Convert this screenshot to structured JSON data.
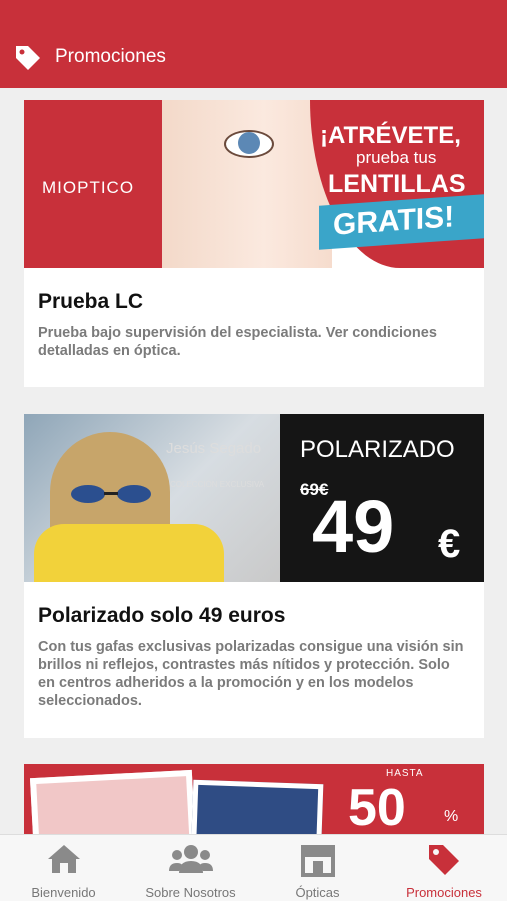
{
  "header": {
    "title": "Promociones",
    "icon": "tag-icon"
  },
  "cards": [
    {
      "title": "Prueba LC",
      "description": "Prueba bajo supervisión del especialista. Ver condiciones detalladas en óptica.",
      "banner": {
        "logo": "MIOPTICO",
        "line1": "¡ATRÉVETE,",
        "line2": "prueba tus",
        "line3": "LENTILLAS",
        "line4": "GRATIS!"
      }
    },
    {
      "title": "Polarizado solo 49 euros",
      "description": "Con tus gafas exclusivas polarizadas consigue una visión sin brillos ni reflejos, contrastes más nítidos y protección. Solo en centros adheridos a la promoción y en los modelos seleccionados.",
      "banner": {
        "brand": "Jesús Segado",
        "collection": "COLECCIÓN EXCLUSIVA",
        "headline": "POLARIZADO",
        "old_price": "69€",
        "price": "49",
        "currency": "€"
      }
    },
    {
      "banner": {
        "hasta": "HASTA",
        "discount": "50",
        "percent": "%"
      }
    }
  ],
  "nav": [
    {
      "label": "Bienvenido",
      "icon": "home-icon"
    },
    {
      "label": "Sobre Nosotros",
      "icon": "users-icon"
    },
    {
      "label": "Ópticas",
      "icon": "store-icon"
    },
    {
      "label": "Promociones",
      "icon": "tag-icon",
      "active": true
    }
  ],
  "colors": {
    "brand_red": "#c8303a",
    "muted_text": "#7b7b7b"
  }
}
